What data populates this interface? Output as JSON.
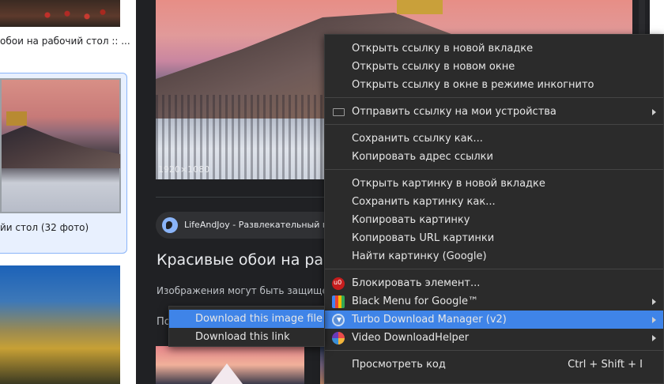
{
  "left": {
    "caption_top": "обои на рабочий стол :: ...",
    "caption_card": "йи стол (32 фото)"
  },
  "preview": {
    "resolution": "1920×1080",
    "source": "LifeAndJoy - Развлекательный по",
    "title": "Красивые обои на рабоч",
    "note": "Изображения могут быть защищены",
    "more": "По"
  },
  "context_menu": {
    "items": [
      {
        "label": "Открыть ссылку в новой вкладке"
      },
      {
        "label": "Открыть ссылку в новом окне"
      },
      {
        "label": "Открыть ссылку в окне в режиме инкогнито"
      },
      {
        "label": "Отправить ссылку на мои устройства",
        "icon": "device-icon",
        "submenu": true
      },
      {
        "label": "Сохранить ссылку как..."
      },
      {
        "label": "Копировать адрес ссылки"
      },
      {
        "label": "Открыть картинку в новой вкладке"
      },
      {
        "label": "Сохранить картинку как..."
      },
      {
        "label": "Копировать картинку"
      },
      {
        "label": "Копировать URL картинки"
      },
      {
        "label": "Найти картинку (Google)"
      },
      {
        "label": "Блокировать элемент...",
        "icon": "ublock-icon"
      },
      {
        "label": "Black Menu for Google™",
        "icon": "black-menu-icon",
        "submenu": true
      },
      {
        "label": "Turbo Download Manager (v2)",
        "icon": "turbo-download-icon",
        "submenu": true,
        "highlighted": true
      },
      {
        "label": "Video DownloadHelper",
        "icon": "video-downloadhelper-icon",
        "submenu": true
      },
      {
        "label": "Просмотреть код",
        "shortcut": "Ctrl + Shift + I"
      }
    ]
  },
  "submenu": {
    "items": [
      {
        "label": "Download this image file",
        "highlighted": true
      },
      {
        "label": "Download this link"
      }
    ]
  },
  "colors": {
    "highlight": "#3f84e8",
    "menu_bg": "#2b2b2b",
    "panel_bg": "#202124"
  }
}
